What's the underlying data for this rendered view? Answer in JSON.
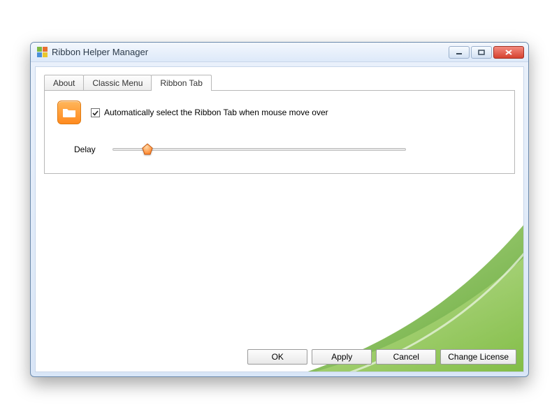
{
  "window": {
    "title": "Ribbon Helper Manager"
  },
  "tabs": [
    {
      "label": "About"
    },
    {
      "label": "Classic Menu"
    },
    {
      "label": "Ribbon Tab"
    }
  ],
  "active_tab_index": 2,
  "settings": {
    "auto_select_label": "Automatically select the Ribbon Tab when mouse move over",
    "auto_select_checked": true,
    "delay_label": "Delay",
    "delay_value_percent": 12
  },
  "buttons": {
    "ok": "OK",
    "apply": "Apply",
    "cancel": "Cancel",
    "change_license": "Change License"
  }
}
